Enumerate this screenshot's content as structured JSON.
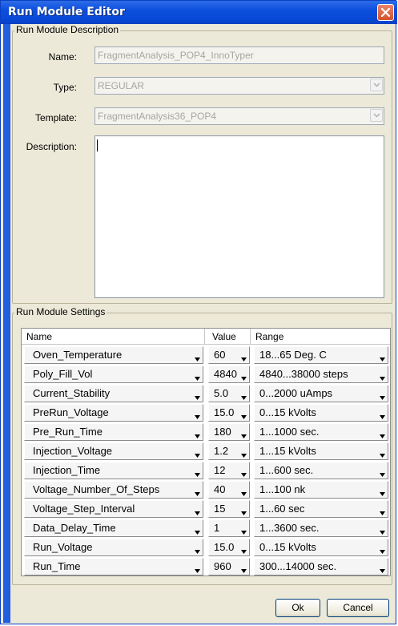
{
  "window": {
    "title": "Run Module Editor"
  },
  "description_group": {
    "legend": "Run Module Description",
    "name_label": "Name:",
    "name_value": "FragmentAnalysis_POP4_InnoTyper",
    "type_label": "Type:",
    "type_value": "REGULAR",
    "template_label": "Template:",
    "template_value": "FragmentAnalysis36_POP4",
    "description_label": "Description:",
    "description_value": ""
  },
  "settings_group": {
    "legend": "Run Module Settings",
    "columns": {
      "name": "Name",
      "value": "Value",
      "range": "Range"
    },
    "rows": [
      {
        "name": "Oven_Temperature",
        "value": "60",
        "range": "18...65 Deg. C"
      },
      {
        "name": "Poly_Fill_Vol",
        "value": "4840",
        "range": "4840...38000 steps"
      },
      {
        "name": "Current_Stability",
        "value": "5.0",
        "range": "0...2000 uAmps"
      },
      {
        "name": "PreRun_Voltage",
        "value": "15.0",
        "range": "0...15 kVolts"
      },
      {
        "name": "Pre_Run_Time",
        "value": "180",
        "range": "1...1000 sec."
      },
      {
        "name": "Injection_Voltage",
        "value": "1.2",
        "range": "1...15 kVolts"
      },
      {
        "name": "Injection_Time",
        "value": "12",
        "range": "1...600 sec."
      },
      {
        "name": "Voltage_Number_Of_Steps",
        "value": "40",
        "range": "1...100 nk"
      },
      {
        "name": "Voltage_Step_Interval",
        "value": "15",
        "range": "1...60 sec"
      },
      {
        "name": "Data_Delay_Time",
        "value": "1",
        "range": "1...3600 sec."
      },
      {
        "name": "Run_Voltage",
        "value": "15.0",
        "range": "0...15 kVolts"
      },
      {
        "name": "Run_Time",
        "value": "960",
        "range": "300...14000 sec."
      }
    ]
  },
  "buttons": {
    "ok": "Ok",
    "cancel": "Cancel"
  }
}
